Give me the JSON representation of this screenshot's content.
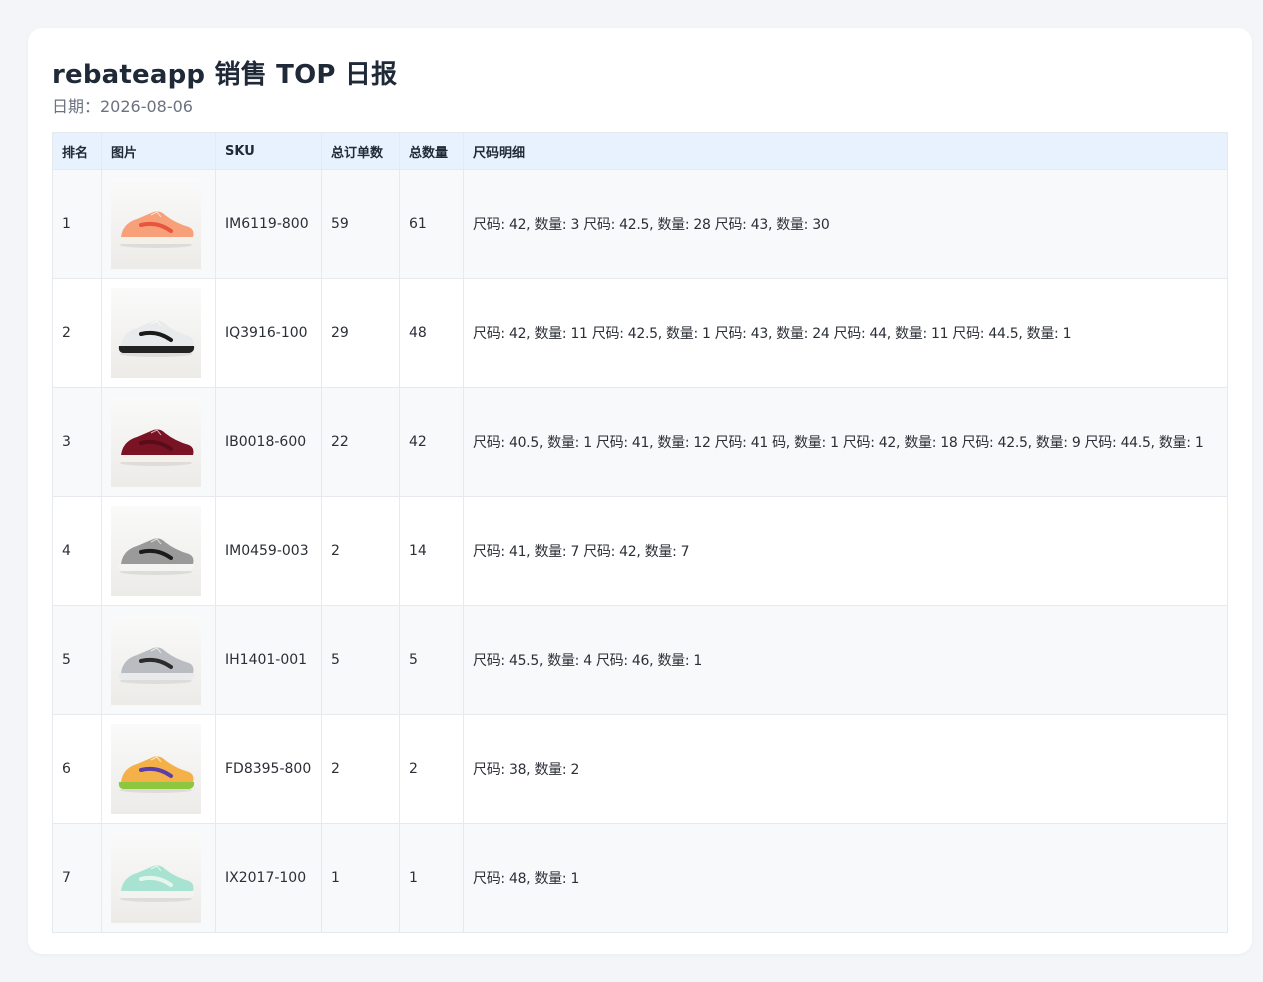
{
  "header": {
    "title": "rebateapp 销售 TOP 日报",
    "date_label": "日期：2026-08-06"
  },
  "columns": [
    "排名",
    "图片",
    "SKU",
    "总订单数",
    "总数量",
    "尺码明细"
  ],
  "rows": [
    {
      "rank": "1",
      "sku": "IM6119-800",
      "orders": "59",
      "quantity": "61",
      "sizes": "尺码: 42, 数量: 3 尺码: 42.5, 数量: 28 尺码: 43, 数量: 30",
      "image": "shoe-icon",
      "colors": {
        "upper": "#f7a07a",
        "accent": "#e8553c",
        "sole": "#f3efe9"
      }
    },
    {
      "rank": "2",
      "sku": "IQ3916-100",
      "orders": "29",
      "quantity": "48",
      "sizes": "尺码: 42, 数量: 11 尺码: 42.5, 数量: 1 尺码: 43, 数量: 24 尺码: 44, 数量: 11 尺码: 44.5, 数量: 1",
      "image": "shoe-icon",
      "colors": {
        "upper": "#e9eaec",
        "accent": "#1a1a1a",
        "sole": "#222222"
      }
    },
    {
      "rank": "3",
      "sku": "IB0018-600",
      "orders": "22",
      "quantity": "42",
      "sizes": "尺码: 40.5, 数量: 1 尺码: 41, 数量: 12 尺码: 41 码, 数量: 1 尺码: 42, 数量: 18 尺码: 42.5, 数量: 9 尺码: 44.5, 数量: 1",
      "image": "shoe-icon",
      "colors": {
        "upper": "#7a1424",
        "accent": "#5a0d19",
        "sole": "#f5f0ea"
      }
    },
    {
      "rank": "4",
      "sku": "IM0459-003",
      "orders": "2",
      "quantity": "14",
      "sizes": "尺码: 41, 数量: 7 尺码: 42, 数量: 7",
      "image": "shoe-icon",
      "colors": {
        "upper": "#9a9a9a",
        "accent": "#1b1b1b",
        "sole": "#f4f4f2"
      }
    },
    {
      "rank": "5",
      "sku": "IH1401-001",
      "orders": "5",
      "quantity": "5",
      "sizes": "尺码: 45.5, 数量: 4 尺码: 46, 数量: 1",
      "image": "shoe-icon",
      "colors": {
        "upper": "#b9bcc0",
        "accent": "#2b2b2b",
        "sole": "#e9eaeb"
      }
    },
    {
      "rank": "6",
      "sku": "FD8395-800",
      "orders": "2",
      "quantity": "2",
      "sizes": "尺码: 38, 数量: 2",
      "image": "shoe-icon",
      "colors": {
        "upper": "#f4b14a",
        "accent": "#5a3fa8",
        "sole": "#8dc63f"
      }
    },
    {
      "rank": "7",
      "sku": "IX2017-100",
      "orders": "1",
      "quantity": "1",
      "sizes": "尺码: 48, 数量: 1",
      "image": "shoe-icon",
      "colors": {
        "upper": "#a8e3d2",
        "accent": "#e6f6ef",
        "sole": "#f3f3f1"
      }
    }
  ]
}
